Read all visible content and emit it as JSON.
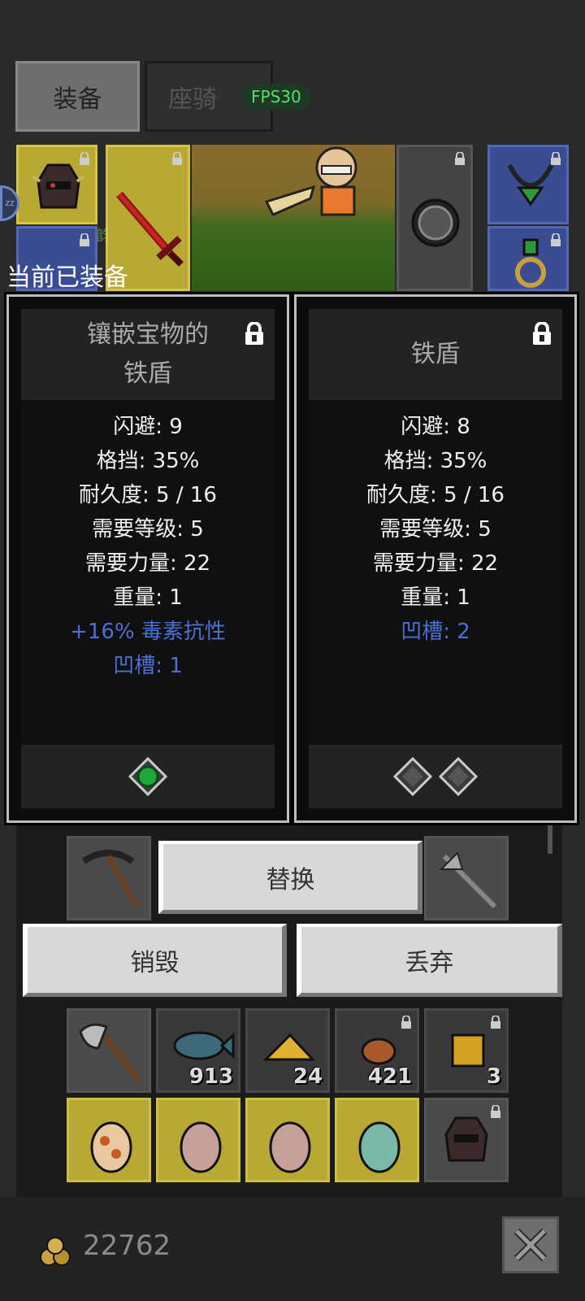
{
  "tabs": [
    {
      "label": "装备",
      "active": true
    },
    {
      "label": "座骑",
      "active": false
    }
  ],
  "fps_label": "FPS30",
  "avatar_badge": "zz",
  "side_text": "韵",
  "equipped_label": "当前已装备",
  "cards": [
    {
      "title_line1": "镶嵌宝物的",
      "title_line2": "铁盾",
      "stats": [
        {
          "text": "闪避: 9",
          "color": "white"
        },
        {
          "text": "格挡: 35%",
          "color": "white"
        },
        {
          "text": "耐久度: 5 / 16",
          "color": "white"
        },
        {
          "text": "需要等级: 5",
          "color": "white"
        },
        {
          "text": "需要力量: 22",
          "color": "white"
        },
        {
          "text": "重量: 1",
          "color": "white"
        },
        {
          "text": "+16% 毒素抗性",
          "color": "blue"
        },
        {
          "text": "凹槽: 1",
          "color": "blue"
        }
      ],
      "sockets": [
        "emerald-gem",
        "none"
      ]
    },
    {
      "title_line1": "铁盾",
      "title_line2": "",
      "stats": [
        {
          "text": "闪避: 8",
          "color": "white"
        },
        {
          "text": "格挡: 35%",
          "color": "white"
        },
        {
          "text": "耐久度: 5 / 16",
          "color": "white"
        },
        {
          "text": "需要等级: 5",
          "color": "white"
        },
        {
          "text": "需要力量: 22",
          "color": "white"
        },
        {
          "text": "重量: 1",
          "color": "white"
        },
        {
          "text": "凹槽: 2",
          "color": "blue"
        }
      ],
      "sockets": [
        "empty",
        "empty"
      ]
    }
  ],
  "buttons": {
    "replace": "替换",
    "destroy": "销毁",
    "discard": "丢弃"
  },
  "inventory_counts": {
    "fish": "913",
    "cheese": "24",
    "ore": "421",
    "gold_block": "3"
  },
  "gold": "22762",
  "colors": {
    "blue_stat": "#4b6fd6",
    "yellow_slot": "#b9a934",
    "blue_slot": "#3b4d92",
    "fps_green": "#55e06a"
  }
}
